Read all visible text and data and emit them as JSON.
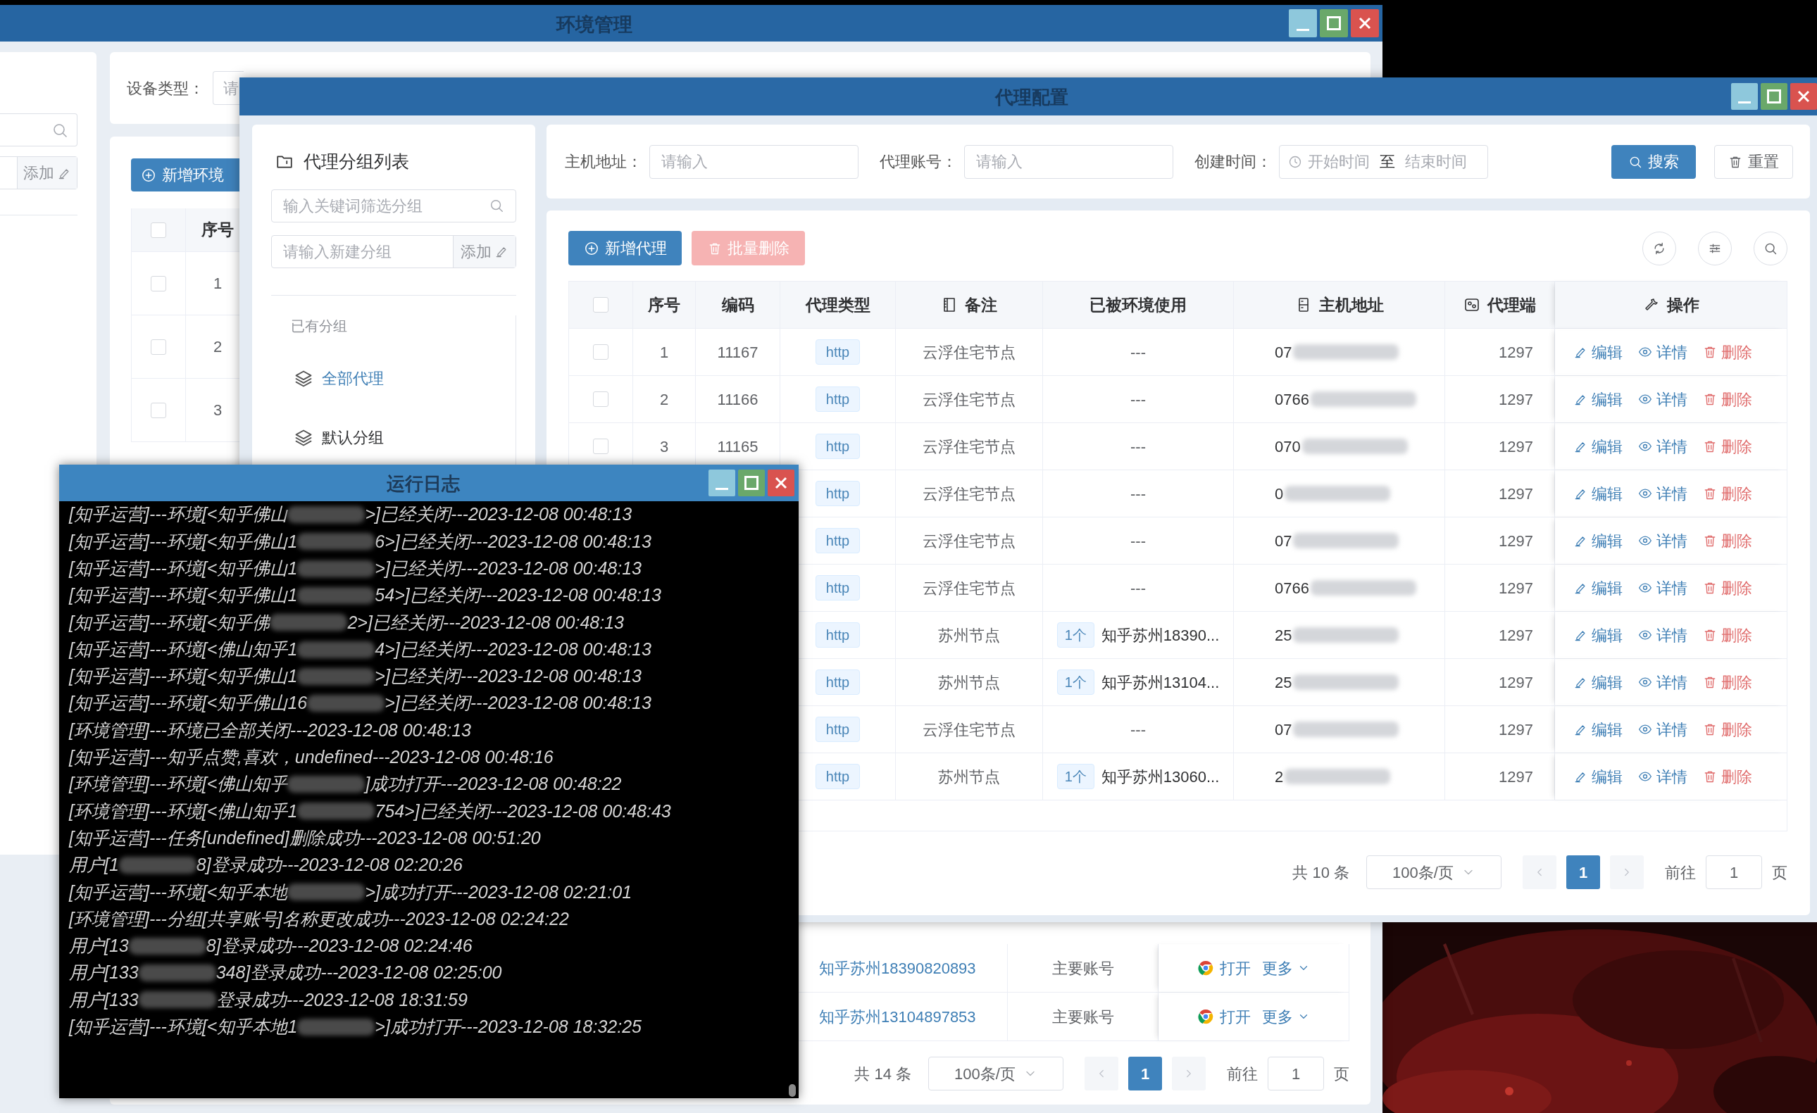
{
  "env_window": {
    "title": "环境管理",
    "sidebar": {
      "add_button": "添加"
    },
    "filter": {
      "label": "设备类型：",
      "select_placeholder": "请"
    },
    "add_button": "新增环境",
    "table": {
      "header_checked": false,
      "column": "序号",
      "rows": [
        {
          "checked": false,
          "seq": "1"
        },
        {
          "checked": false,
          "seq": "2"
        },
        {
          "checked": false,
          "seq": "3"
        }
      ],
      "bottom_rows": [
        {
          "account": "知乎苏州18390820893",
          "type": "主要账号",
          "open": "打开",
          "more": "更多"
        },
        {
          "account": "知乎苏州13104897853",
          "type": "主要账号",
          "open": "打开",
          "more": "更多"
        }
      ]
    },
    "pagination": {
      "total": "共 14 条",
      "page_size": "100条/页",
      "pages": [
        {
          "label": "1",
          "selected": true
        }
      ],
      "goto_label": "前往",
      "goto_value": "1",
      "unit": "页"
    }
  },
  "proxy_window": {
    "title": "代理配置",
    "groups": {
      "title": "代理分组列表",
      "search_placeholder": "输入关键词筛选分组",
      "new_placeholder": "请输入新建分组",
      "add_button": "添加",
      "section": "已有分组",
      "items": [
        {
          "label": "全部代理",
          "selected": true
        },
        {
          "label": "默认分组",
          "selected": false
        }
      ]
    },
    "filter": {
      "host_label": "主机地址：",
      "host_placeholder": "请输入",
      "account_label": "代理账号：",
      "account_placeholder": "请输入",
      "time_label": "创建时间：",
      "start_placeholder": "开始时间",
      "separator": "至",
      "end_placeholder": "结束时间",
      "search_button": "搜索",
      "reset_button": "重置"
    },
    "toolbar": {
      "add_button": "新增代理",
      "batch_delete_button": "批量删除",
      "batch_delete_disabled": true
    },
    "table": {
      "header_checked": false,
      "columns": [
        "序号",
        "编码",
        "代理类型",
        "备注",
        "已被环境使用",
        "主机地址",
        "代理端",
        "操作"
      ],
      "rows": [
        {
          "checked": false,
          "seq": "1",
          "code": "11167",
          "type": "http",
          "note": "云浮住宅节点",
          "used": "---",
          "host": "07",
          "port": "1297",
          "actions": [
            "编辑",
            "详情",
            "删除"
          ]
        },
        {
          "checked": false,
          "seq": "2",
          "code": "11166",
          "type": "http",
          "note": "云浮住宅节点",
          "used": "---",
          "host": "0766",
          "port": "1297",
          "actions": [
            "编辑",
            "详情",
            "删除"
          ]
        },
        {
          "checked": false,
          "seq": "3",
          "code": "11165",
          "type": "http",
          "note": "云浮住宅节点",
          "used": "---",
          "host": "070",
          "port": "1297",
          "actions": [
            "编辑",
            "详情",
            "删除"
          ]
        },
        {
          "type": "http",
          "note": "云浮住宅节点",
          "used": "---",
          "host": "0",
          "port": "1297",
          "actions": [
            "编辑",
            "详情",
            "删除"
          ]
        },
        {
          "type": "http",
          "note": "云浮住宅节点",
          "used": "---",
          "host": "07",
          "port": "1297",
          "actions": [
            "编辑",
            "详情",
            "删除"
          ]
        },
        {
          "type": "http",
          "note": "云浮住宅节点",
          "used": "---",
          "host": "0766",
          "port": "1297",
          "actions": [
            "编辑",
            "详情",
            "删除"
          ]
        },
        {
          "type": "http",
          "note": "苏州节点",
          "used": {
            "count": "1个",
            "name": "知乎苏州18390..."
          },
          "host": "25",
          "port": "1297",
          "actions": [
            "编辑",
            "详情",
            "删除"
          ]
        },
        {
          "type": "http",
          "note": "苏州节点",
          "used": {
            "count": "1个",
            "name": "知乎苏州13104..."
          },
          "host": "25",
          "port": "1297",
          "actions": [
            "编辑",
            "详情",
            "删除"
          ]
        },
        {
          "type": "http",
          "note": "云浮住宅节点",
          "used": "---",
          "host": "07",
          "port": "1297",
          "actions": [
            "编辑",
            "详情",
            "删除"
          ]
        },
        {
          "type": "http",
          "note": "苏州节点",
          "used": {
            "count": "1个",
            "name": "知乎苏州13060..."
          },
          "host": "2",
          "port": "1297",
          "actions": [
            "编辑",
            "详情",
            "删除"
          ]
        }
      ]
    },
    "pagination": {
      "total": "共 10 条",
      "page_size": "100条/页",
      "pages": [
        {
          "label": "1",
          "selected": true
        }
      ],
      "goto_label": "前往",
      "goto_value": "1",
      "unit": "页"
    }
  },
  "log_window": {
    "title": "运行日志",
    "lines": [
      {
        "parts": [
          "[知乎运营]---环境[<知乎佛山",
          ">]已经关闭---2023-12-08 00:48:13"
        ]
      },
      {
        "parts": [
          "[知乎运营]---环境[<知乎佛山1",
          "6>]已经关闭---2023-12-08 00:48:13"
        ]
      },
      {
        "parts": [
          "[知乎运营]---环境[<知乎佛山1",
          ">]已经关闭---2023-12-08 00:48:13"
        ]
      },
      {
        "parts": [
          "[知乎运营]---环境[<知乎佛山1",
          "54>]已经关闭---2023-12-08 00:48:13"
        ]
      },
      {
        "parts": [
          "[知乎运营]---环境[<知乎佛",
          "2>]已经关闭---2023-12-08 00:48:13"
        ]
      },
      {
        "parts": [
          "[知乎运营]---环境[<佛山知乎1",
          "4>]已经关闭---2023-12-08 00:48:13"
        ]
      },
      {
        "parts": [
          "[知乎运营]---环境[<知乎佛山1",
          ">]已经关闭---2023-12-08 00:48:13"
        ]
      },
      {
        "parts": [
          "[知乎运营]---环境[<知乎佛山16",
          ">]已经关闭---2023-12-08 00:48:13"
        ]
      },
      {
        "parts": [
          "[环境管理]---环境已全部关闭---2023-12-08 00:48:13"
        ]
      },
      {
        "parts": [
          "[知乎运营]---知乎点赞,喜欢，undefined---2023-12-08 00:48:16"
        ]
      },
      {
        "parts": [
          "[环境管理]---环境[<佛山知乎",
          "]成功打开---2023-12-08 00:48:22"
        ]
      },
      {
        "parts": [
          "[环境管理]---环境[<佛山知乎1",
          "754>]已经关闭---2023-12-08 00:48:43"
        ]
      },
      {
        "parts": [
          "[知乎运营]---任务[undefined]删除成功---2023-12-08 00:51:20"
        ]
      },
      {
        "parts": [
          "用户[1",
          "8]登录成功---2023-12-08 02:20:26"
        ]
      },
      {
        "parts": [
          "[知乎运营]---环境[<知乎本地",
          ">]成功打开---2023-12-08 02:21:01"
        ]
      },
      {
        "parts": [
          "[环境管理]---分组[共享账号]名称更改成功---2023-12-08 02:24:22"
        ]
      },
      {
        "parts": [
          "用户[13",
          "8]登录成功---2023-12-08 02:24:46"
        ]
      },
      {
        "parts": [
          "用户[133",
          "348]登录成功---2023-12-08 02:25:00"
        ]
      },
      {
        "parts": [
          "用户[133",
          "登录成功---2023-12-08 18:31:59"
        ]
      },
      {
        "parts": [
          "[知乎运营]---环境[<知乎本地1",
          ">]成功打开---2023-12-08 18:32:25"
        ]
      }
    ]
  }
}
